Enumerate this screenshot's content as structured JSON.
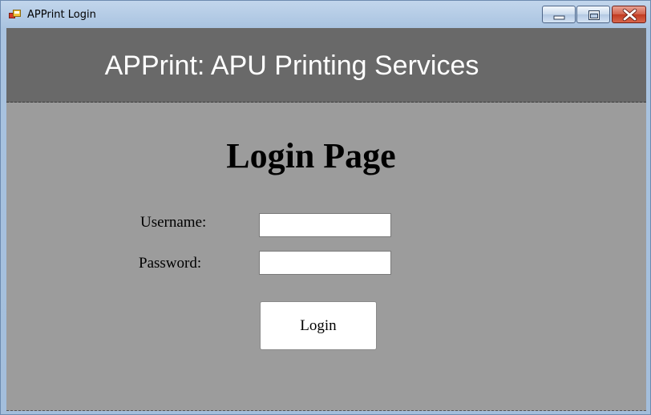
{
  "window": {
    "title": "APPrint Login",
    "icon": "app-window-icon",
    "controls": [
      "minimize-icon",
      "maximize-icon",
      "close-icon"
    ]
  },
  "header": {
    "title": "APPrint: APU Printing Services",
    "background": "#696969"
  },
  "form": {
    "page_title": "Login Page",
    "username_label": "Username:",
    "username_value": "",
    "password_label": "Password:",
    "password_value": "",
    "login_label": "Login"
  },
  "colors": {
    "client_background": "#9c9c9c",
    "header_background": "#696969",
    "close_button": "#c13a21"
  }
}
